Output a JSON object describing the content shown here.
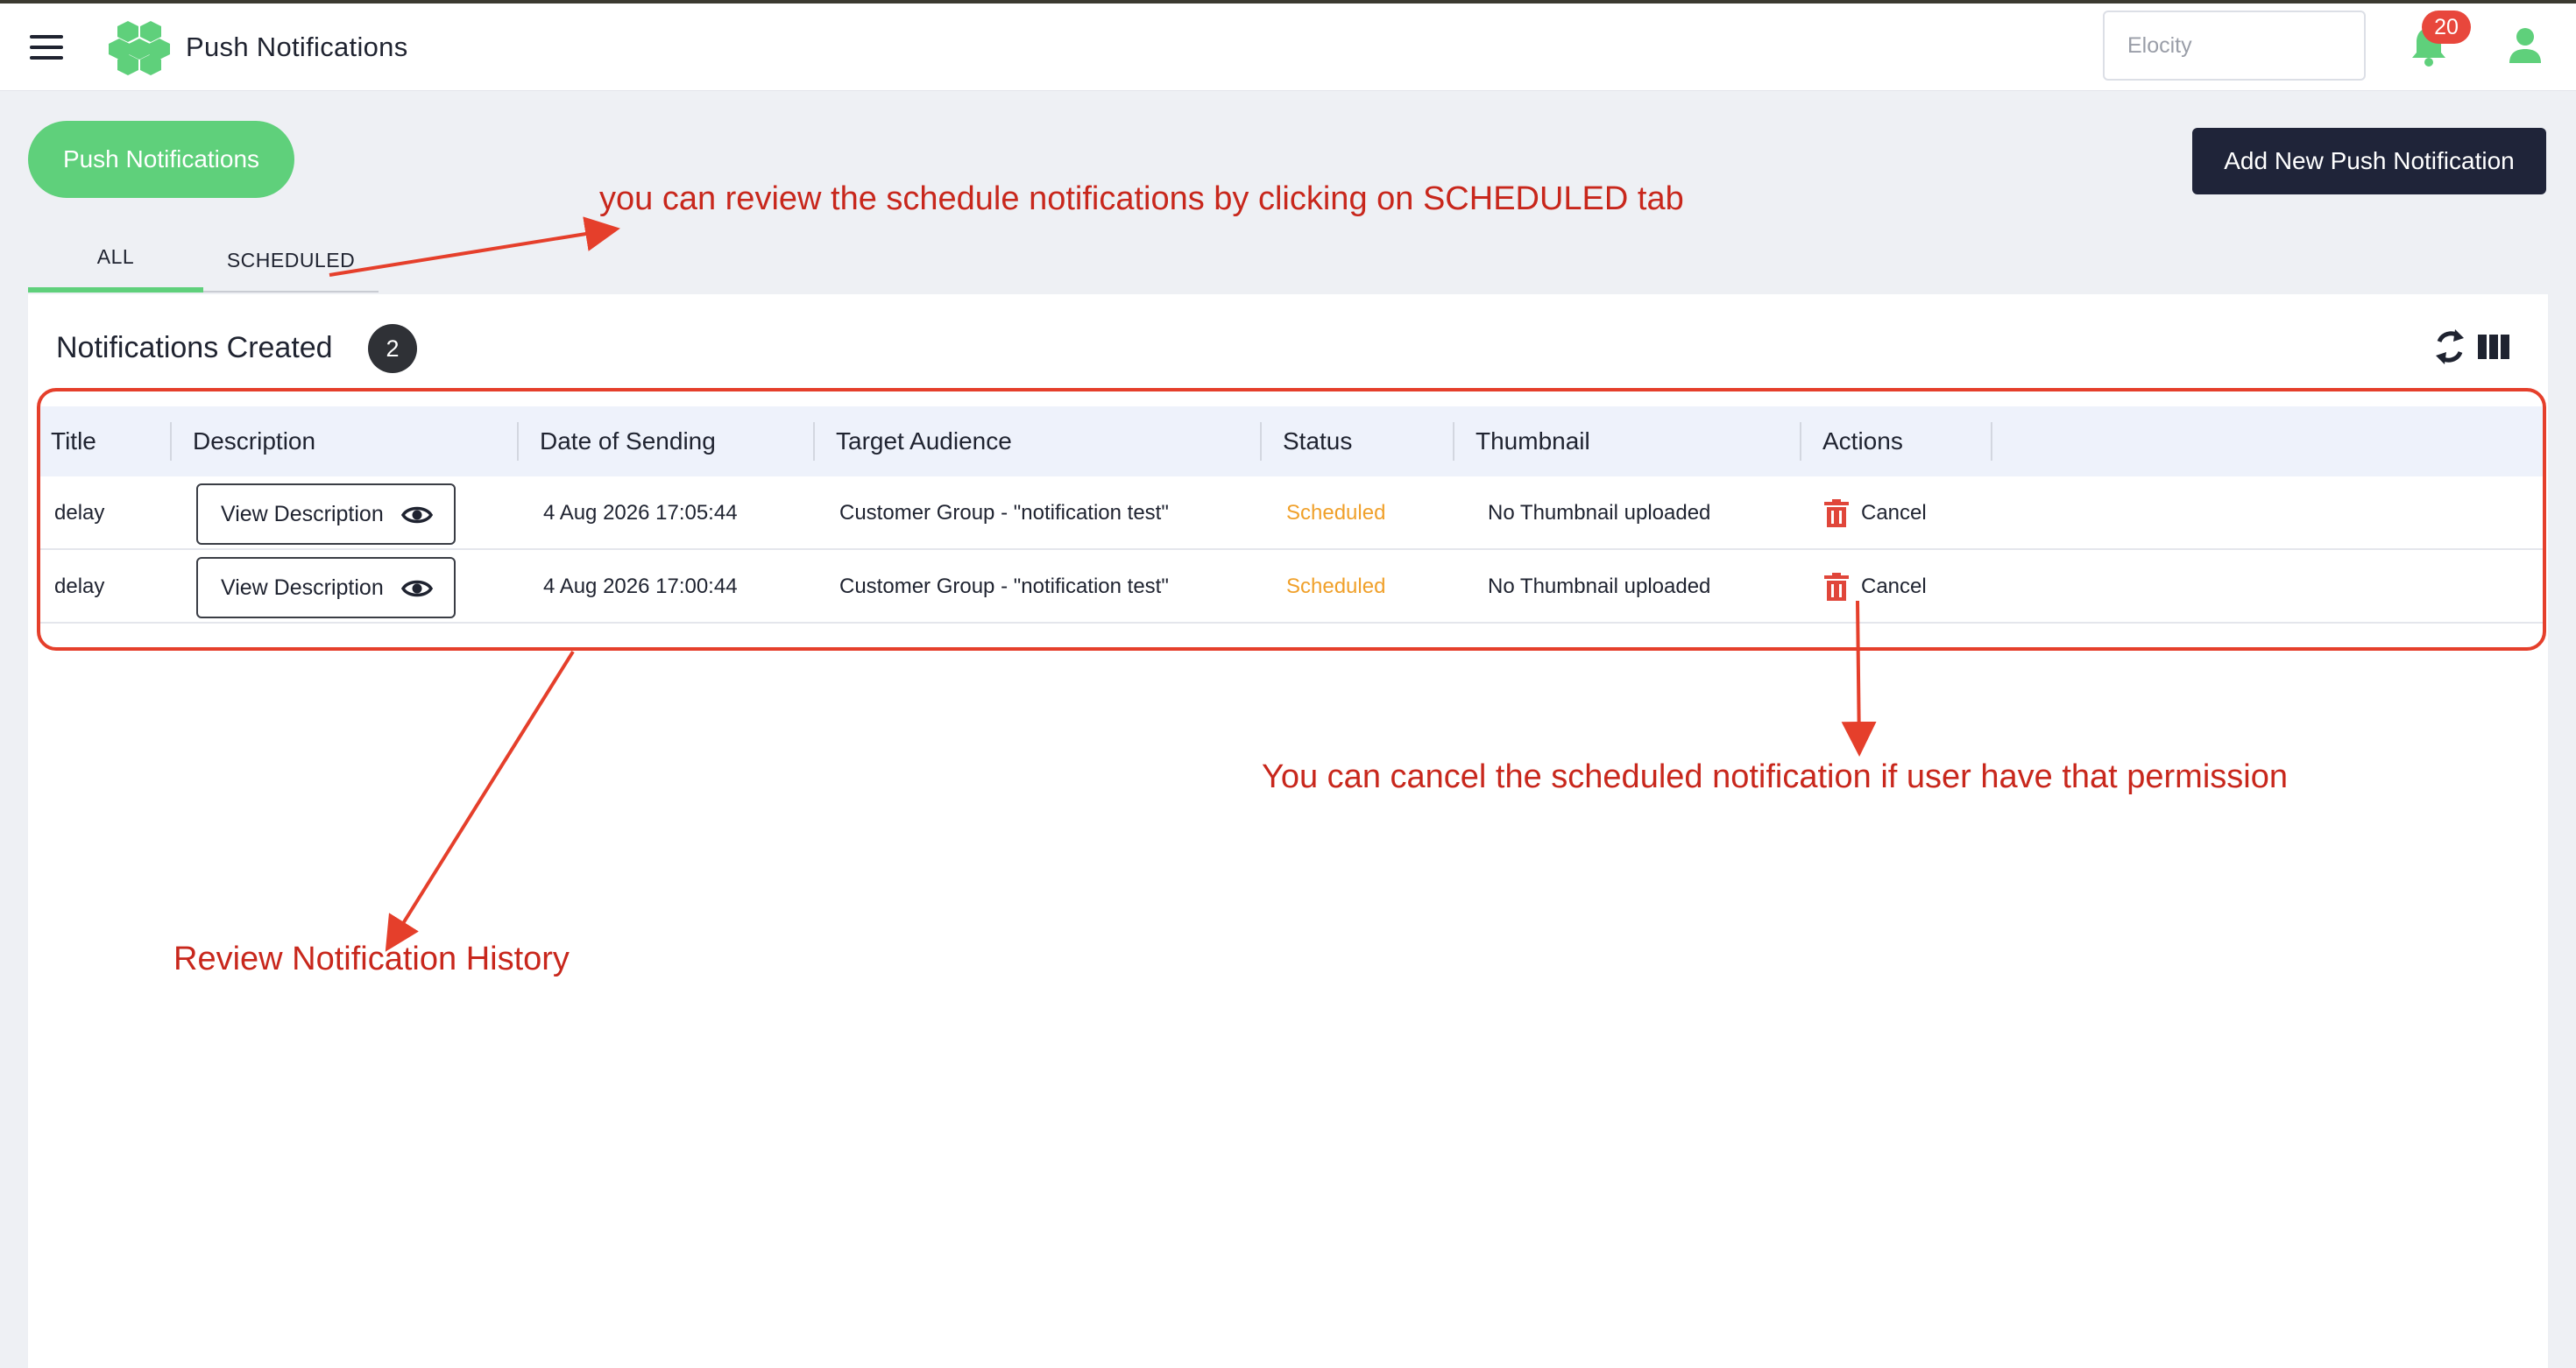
{
  "header": {
    "title": "Push Notifications",
    "tenant_placeholder": "Elocity",
    "notification_count": "20"
  },
  "page": {
    "pill_label": "Push Notifications",
    "add_button_label": "Add New Push Notification"
  },
  "tabs": [
    {
      "label": "ALL",
      "active": true
    },
    {
      "label": "SCHEDULED",
      "active": false
    }
  ],
  "card": {
    "title": "Notifications Created",
    "count": "2"
  },
  "table": {
    "columns": [
      "Title",
      "Description",
      "Date of Sending",
      "Target Audience",
      "Status",
      "Thumbnail",
      "Actions"
    ],
    "rows": [
      {
        "title": "delay",
        "description_button": "View Description",
        "date": "4 Aug 2026 17:05:44",
        "audience": "Customer Group - \"notification test\"",
        "status": "Scheduled",
        "thumbnail": "No Thumbnail uploaded",
        "action": "Cancel"
      },
      {
        "title": "delay",
        "description_button": "View Description",
        "date": "4 Aug 2026 17:00:44",
        "audience": "Customer Group - \"notification test\"",
        "status": "Scheduled",
        "thumbnail": "No Thumbnail uploaded",
        "action": "Cancel"
      }
    ]
  },
  "annotations": {
    "scheduled_tab": "you can review the schedule notifications by clicking on SCHEDULED tab",
    "cancel": "You can cancel the scheduled notification if user have that permission",
    "history": "Review Notification History"
  },
  "colors": {
    "accent_green": "#5fd07b",
    "primary_dark": "#1f2439",
    "badge_red": "#e8473c",
    "status_scheduled": "#f0a02a",
    "annotation_red": "#c8271c"
  },
  "icons": [
    "menu-icon",
    "logo-icon",
    "bell-icon",
    "user-icon",
    "refresh-icon",
    "columns-icon",
    "eye-icon",
    "trash-icon"
  ]
}
